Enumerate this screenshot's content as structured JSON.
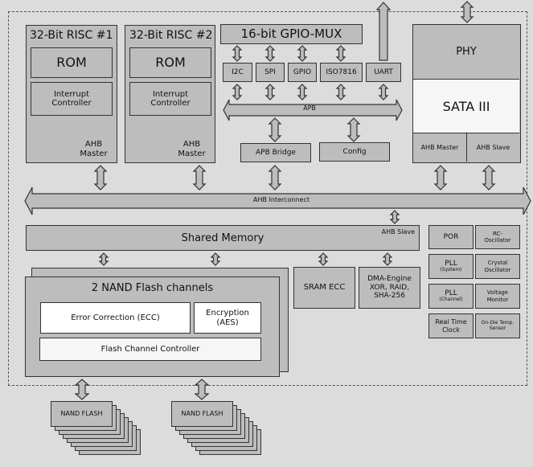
{
  "diagram": {
    "risc1": {
      "title": "32-Bit RISC #1",
      "rom": "ROM",
      "interrupt": "Interrupt Controller",
      "bus_role": "AHB Master"
    },
    "risc2": {
      "title": "32-Bit RISC #2",
      "rom": "ROM",
      "interrupt": "Interrupt Controller",
      "bus_role": "AHB Master"
    },
    "gpio_mux": "16-bit GPIO-MUX",
    "peripherals": [
      "I2C",
      "SPI",
      "GPIO",
      "ISO7816",
      "UART"
    ],
    "apb": "APB",
    "apb_bridge": "APB Bridge",
    "config": "Config",
    "sata": {
      "phy": "PHY",
      "title": "SATA III",
      "master": "AHB Master",
      "slave": "AHB Slave"
    },
    "ahb_interconnect": "AHB Interconnect",
    "shared_memory": {
      "title": "Shared Memory",
      "role": "AHB Slave"
    },
    "nand_channels": {
      "title": "2 NAND Flash channels",
      "ecc": "Error Correction (ECC)",
      "encryption": "Encryption (AES)",
      "controller": "Flash Channel Controller"
    },
    "sram_ecc": "SRAM ECC",
    "dma": "DMA-Engine XOR, RAID, SHA-256",
    "misc": {
      "por": "POR",
      "rc_osc": "RC-Oscillator",
      "pll_sys": "PLL",
      "pll_sys_sub": "(System)",
      "crystal": "Crystal Oscillator",
      "pll_ch": "PLL",
      "pll_ch_sub": "(Channel)",
      "voltage": "Voltage Monitor",
      "rtc": "Real Time Clock",
      "temp": "On-Die Temp. Sensor"
    },
    "nand_flash": [
      "NAND FLASH",
      "NAND FLASH"
    ]
  }
}
